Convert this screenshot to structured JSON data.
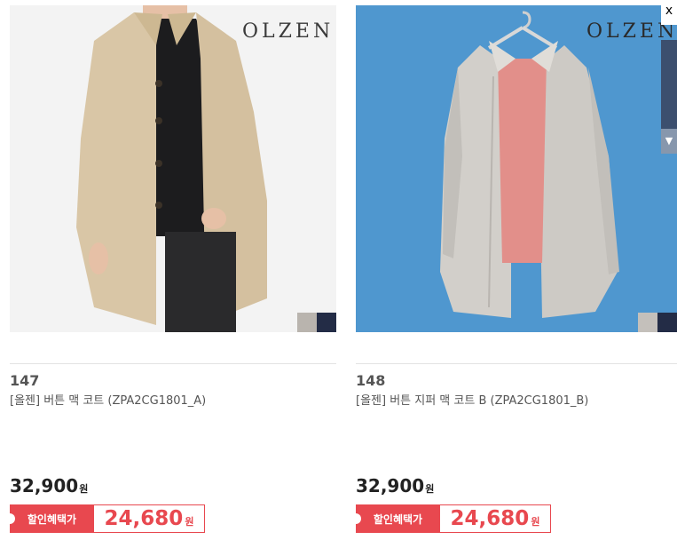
{
  "products": [
    {
      "brand_logo": "OLZEN",
      "number": "147",
      "name": "[올젠] 버튼 맥 코트 (ZPA2CG1801_A)",
      "price": "32,900",
      "price_unit": "원",
      "sale_label": "할인혜택가",
      "sale_price": "24,680",
      "sale_unit": "원",
      "swatches": [
        "#b9b4ae",
        "#232c46"
      ]
    },
    {
      "brand_logo": "OLZEN",
      "number": "148",
      "name": "[올젠] 버튼 지퍼 맥 코트 B (ZPA2CG1801_B)",
      "price": "32,900",
      "price_unit": "원",
      "sale_label": "할인혜택가",
      "sale_price": "24,680",
      "sale_unit": "원",
      "swatches": [
        "#c4c0bb",
        "#232c46"
      ]
    }
  ],
  "colors": {
    "sale_accent": "#e8484f",
    "photo_bg_1": "#f3f3f3",
    "photo_bg_2": "#4f97cf"
  },
  "side_widget": {
    "close_glyph": "x",
    "tab_glyph": "▼"
  }
}
